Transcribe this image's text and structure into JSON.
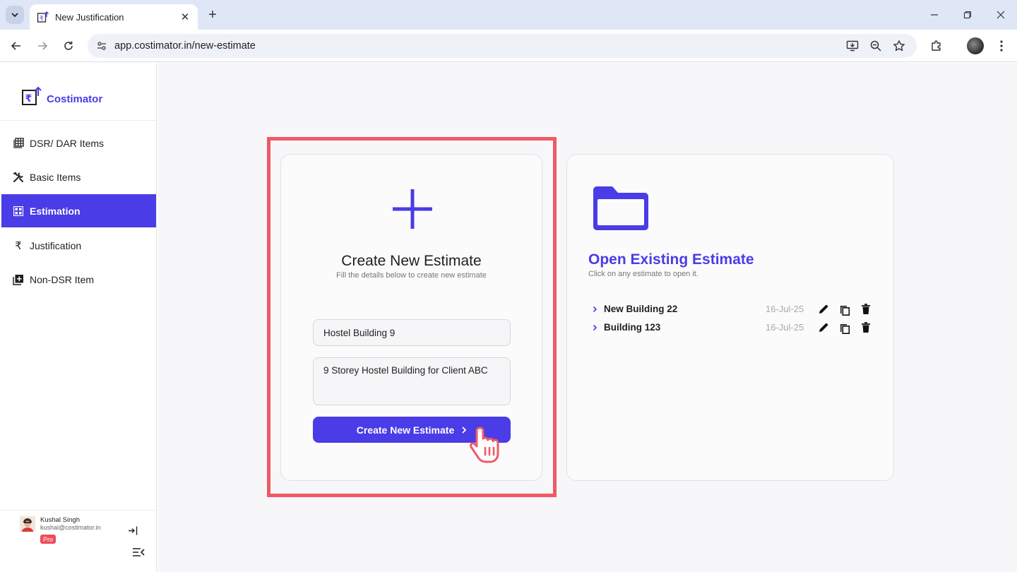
{
  "browser": {
    "tab_title": "New Justification",
    "url": "app.costimator.in/new-estimate"
  },
  "app": {
    "name": "Costimator",
    "brand_color": "#4a3ce6",
    "highlight_color": "#ef5a66"
  },
  "sidebar": {
    "items": [
      {
        "label": "DSR/ DAR Items",
        "icon": "table-grid-icon",
        "active": false
      },
      {
        "label": "Basic Items",
        "icon": "tools-icon",
        "active": false
      },
      {
        "label": "Estimation",
        "icon": "dashboard-grid-icon",
        "active": true
      },
      {
        "label": "Justification",
        "icon": "rupee-icon",
        "active": false
      },
      {
        "label": "Non-DSR Item",
        "icon": "add-box-icon",
        "active": false
      }
    ],
    "user": {
      "name": "Kushal Singh",
      "email": "kushal@costimator.in",
      "plan": "Pro"
    }
  },
  "create_card": {
    "title": "Create New Estimate",
    "subtitle": "Fill the details below to create new estimate",
    "name_value": "Hostel Building 9",
    "description_value": "9 Storey Hostel Building for Client ABC",
    "button_label": "Create New Estimate"
  },
  "open_card": {
    "title": "Open Existing Estimate",
    "subtitle": "Click on any estimate to open it.",
    "estimates": [
      {
        "name": "New Building 22",
        "date": "16-Jul-25"
      },
      {
        "name": "Building 123",
        "date": "16-Jul-25"
      }
    ]
  }
}
